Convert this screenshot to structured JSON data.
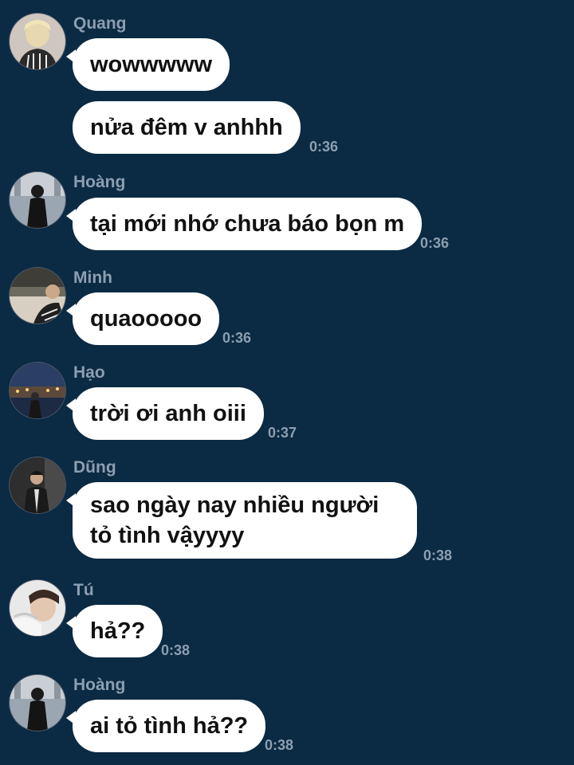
{
  "colors": {
    "background": "#0b2a43",
    "bubble": "#ffffff",
    "meta_text": "#8c9fb1"
  },
  "messages": [
    {
      "sender": "Quang",
      "avatar_icon": "user-avatar-icon",
      "bubbles": [
        "wowwwww",
        "nửa đêm v anhhh"
      ],
      "time": "0:36"
    },
    {
      "sender": "Hoàng",
      "avatar_icon": "user-avatar-icon",
      "bubbles": [
        "tại mới nhớ chưa báo bọn m"
      ],
      "time": "0:36"
    },
    {
      "sender": "Minh",
      "avatar_icon": "user-avatar-icon",
      "bubbles": [
        "quaooooo"
      ],
      "time": "0:36"
    },
    {
      "sender": "Hạo",
      "avatar_icon": "user-avatar-icon",
      "bubbles": [
        "trời ơi anh oiii"
      ],
      "time": "0:37"
    },
    {
      "sender": "Dũng",
      "avatar_icon": "user-avatar-icon",
      "bubbles": [
        "sao ngày nay nhiều người tỏ tình vậyyyy"
      ],
      "time": "0:38"
    },
    {
      "sender": "Tú",
      "avatar_icon": "user-avatar-icon",
      "bubbles": [
        "hả??"
      ],
      "time": "0:38"
    },
    {
      "sender": "Hoàng",
      "avatar_icon": "user-avatar-icon",
      "bubbles": [
        "ai tỏ tình hả??"
      ],
      "time": "0:38"
    }
  ]
}
